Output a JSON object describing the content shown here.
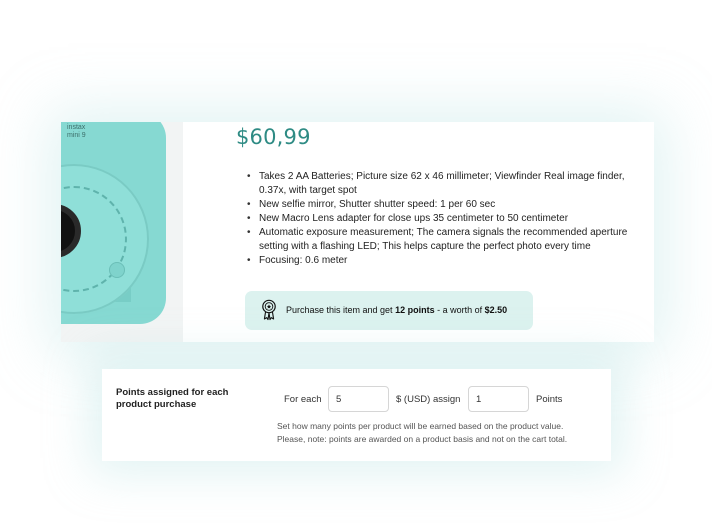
{
  "product": {
    "camera_label_line1": "instax",
    "camera_label_line2": "mini 9",
    "price": "$60,99",
    "features": [
      "Takes 2 AA Batteries; Picture size 62 x 46 millimeter; Viewfinder Real image finder, 0.37x, with target spot",
      "New selfie mirror, Shutter shutter speed: 1 per 60 sec",
      "New Macro Lens adapter for close ups 35 centimeter to 50 centimeter",
      "Automatic exposure measurement; The camera signals the recommended aperture setting with a flashing LED; This helps capture the perfect photo every time",
      "Focusing: 0.6 meter"
    ],
    "points_banner": {
      "prefix": "Purchase this item and get ",
      "points": "12 points",
      "middle": " - a worth of ",
      "worth": "$2.50"
    }
  },
  "settings": {
    "title": "Points assigned for each product purchase",
    "for_each_label": "For each",
    "amount_value": "5",
    "currency_label": "$ (USD) assign",
    "points_value": "1",
    "points_label": "Points",
    "help_line1": "Set how many points per product will be earned based on the product value.",
    "help_line2": "Please, note: points are awarded on a product basis and not on the cart total."
  },
  "colors": {
    "accent": "#2e8b84",
    "banner_bg": "#dcf2ef",
    "camera": "#86d9d2"
  },
  "icons": {
    "banner_icon": "award-ribbon-icon"
  }
}
